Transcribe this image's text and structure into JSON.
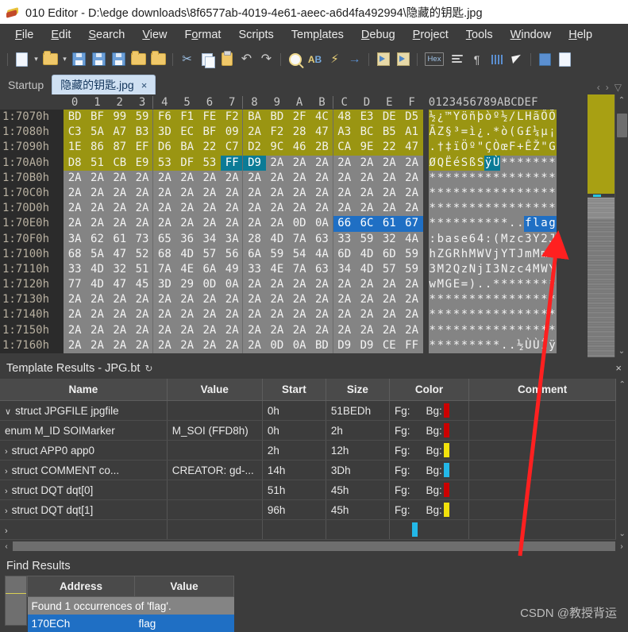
{
  "window": {
    "title": "010 Editor - D:\\edge downloads\\8f6577ab-4019-4e61-aeec-a6d4fa492994\\隐藏的钥匙.jpg",
    "app_icon": "010-editor-icon"
  },
  "menubar": {
    "items": [
      {
        "label": "File"
      },
      {
        "label": "Edit"
      },
      {
        "label": "Search"
      },
      {
        "label": "View"
      },
      {
        "label": "Format"
      },
      {
        "label": "Scripts"
      },
      {
        "label": "Templates"
      },
      {
        "label": "Debug"
      },
      {
        "label": "Project"
      },
      {
        "label": "Tools"
      },
      {
        "label": "Window"
      },
      {
        "label": "Help"
      }
    ]
  },
  "toolbar": {
    "buttons": [
      "new-file-icon",
      "new-file-dropdown-icon",
      "open-folder-icon",
      "open-dropdown-icon",
      "save-icon",
      "save-as-icon",
      "save-all-icon",
      "open-file-icon",
      "open-all-icon",
      "cut-icon",
      "copy-icon",
      "paste-icon",
      "undo-icon",
      "redo-icon",
      "find-icon",
      "replace-icon",
      "find-in-files-icon",
      "goto-icon",
      "run-script-icon",
      "run-template-icon",
      "hex-mode-button",
      "byte-order-icon",
      "paragraph-icon",
      "column-mode-icon",
      "inspector-icon",
      "calculator-icon",
      "help-icon"
    ],
    "hex_label": "Hex"
  },
  "tabs": {
    "items": [
      {
        "label": "Startup",
        "active": false,
        "closable": false
      },
      {
        "label": "隐藏的钥匙.jpg",
        "active": true,
        "closable": true,
        "close_label": "×"
      }
    ],
    "nav_prev": "‹",
    "nav_next": "›",
    "nav_list": "▽"
  },
  "hex_view": {
    "column_headers": [
      "0",
      "1",
      "2",
      "3",
      "4",
      "5",
      "6",
      "7",
      "8",
      "9",
      "A",
      "B",
      "C",
      "D",
      "E",
      "F"
    ],
    "ascii_header": "0123456789ABCDEF",
    "rows": [
      {
        "addr": "1:7070h",
        "bytes": [
          "BD",
          "BF",
          "99",
          "59",
          "F6",
          "F1",
          "FE",
          "F2",
          "BA",
          "BD",
          "2F",
          "4C",
          "48",
          "E3",
          "DE",
          "D5"
        ],
        "hl": [
          "o",
          "o",
          "o",
          "o",
          "o",
          "o",
          "o",
          "o",
          "o",
          "o",
          "o",
          "o",
          "o",
          "o",
          "o",
          "o"
        ],
        "ascii": "½¿™Yöñþòº½/LHãŐÕ",
        "ascii_hl": "o"
      },
      {
        "addr": "1:7080h",
        "bytes": [
          "C3",
          "5A",
          "A7",
          "B3",
          "3D",
          "EC",
          "BF",
          "09",
          "2A",
          "F2",
          "28",
          "47",
          "A3",
          "BC",
          "B5",
          "A1"
        ],
        "hl": [
          "o",
          "o",
          "o",
          "o",
          "o",
          "o",
          "o",
          "o",
          "o",
          "o",
          "o",
          "o",
          "o",
          "o",
          "o",
          "o"
        ],
        "ascii": "ÃZ§³=ì¿.*ò(G£¼µ¡",
        "ascii_hl": "o"
      },
      {
        "addr": "1:7090h",
        "bytes": [
          "1E",
          "86",
          "87",
          "EF",
          "D6",
          "BA",
          "22",
          "C7",
          "D2",
          "9C",
          "46",
          "2B",
          "CA",
          "9E",
          "22",
          "47"
        ],
        "hl": [
          "o",
          "o",
          "o",
          "o",
          "o",
          "o",
          "o",
          "o",
          "o",
          "o",
          "o",
          "o",
          "o",
          "o",
          "o",
          "o"
        ],
        "ascii": ".†‡ïÖº\"ÇÒœF+ÊŽ\"G",
        "ascii_hl": "o"
      },
      {
        "addr": "1:70A0h",
        "bytes": [
          "D8",
          "51",
          "CB",
          "E9",
          "53",
          "DF",
          "53",
          "FF",
          "D9",
          "2A",
          "2A",
          "2A",
          "2A",
          "2A",
          "2A",
          "2A"
        ],
        "hl": [
          "o",
          "o",
          "o",
          "o",
          "o",
          "o",
          "o",
          "t",
          "t",
          "g",
          "g",
          "g",
          "g",
          "g",
          "g",
          "g"
        ],
        "ascii": "ØQËéSßSÿÙ*******",
        "ascii_hl": "mixed-olive-teal"
      },
      {
        "addr": "1:70B0h",
        "bytes": [
          "2A",
          "2A",
          "2A",
          "2A",
          "2A",
          "2A",
          "2A",
          "2A",
          "2A",
          "2A",
          "2A",
          "2A",
          "2A",
          "2A",
          "2A",
          "2A"
        ],
        "hl": [
          "g",
          "g",
          "g",
          "g",
          "g",
          "g",
          "g",
          "g",
          "g",
          "g",
          "g",
          "g",
          "g",
          "g",
          "g",
          "g"
        ],
        "ascii": "****************",
        "ascii_hl": "g"
      },
      {
        "addr": "1:70C0h",
        "bytes": [
          "2A",
          "2A",
          "2A",
          "2A",
          "2A",
          "2A",
          "2A",
          "2A",
          "2A",
          "2A",
          "2A",
          "2A",
          "2A",
          "2A",
          "2A",
          "2A"
        ],
        "hl": [
          "g",
          "g",
          "g",
          "g",
          "g",
          "g",
          "g",
          "g",
          "g",
          "g",
          "g",
          "g",
          "g",
          "g",
          "g",
          "g"
        ],
        "ascii": "****************",
        "ascii_hl": "g"
      },
      {
        "addr": "1:70D0h",
        "bytes": [
          "2A",
          "2A",
          "2A",
          "2A",
          "2A",
          "2A",
          "2A",
          "2A",
          "2A",
          "2A",
          "2A",
          "2A",
          "2A",
          "2A",
          "2A",
          "2A"
        ],
        "hl": [
          "g",
          "g",
          "g",
          "g",
          "g",
          "g",
          "g",
          "g",
          "g",
          "g",
          "g",
          "g",
          "g",
          "g",
          "g",
          "g"
        ],
        "ascii": "****************",
        "ascii_hl": "g"
      },
      {
        "addr": "1:70E0h",
        "bytes": [
          "2A",
          "2A",
          "2A",
          "2A",
          "2A",
          "2A",
          "2A",
          "2A",
          "2A",
          "2A",
          "0D",
          "0A",
          "66",
          "6C",
          "61",
          "67"
        ],
        "hl": [
          "g",
          "g",
          "g",
          "g",
          "g",
          "g",
          "g",
          "g",
          "g",
          "g",
          "g",
          "g",
          "b",
          "b",
          "b",
          "b"
        ],
        "ascii": "**********..flag",
        "ascii_hl": "gray-then-blue-4"
      },
      {
        "addr": "1:70F0h",
        "bytes": [
          "3A",
          "62",
          "61",
          "73",
          "65",
          "36",
          "34",
          "3A",
          "28",
          "4D",
          "7A",
          "63",
          "33",
          "59",
          "32",
          "4A"
        ],
        "hl": [
          "g",
          "g",
          "g",
          "g",
          "g",
          "g",
          "g",
          "g",
          "g",
          "g",
          "g",
          "g",
          "g",
          "g",
          "g",
          "g"
        ],
        "ascii": ":base64:(Mzc3Y2J",
        "ascii_hl": "g"
      },
      {
        "addr": "1:7100h",
        "bytes": [
          "68",
          "5A",
          "47",
          "52",
          "68",
          "4D",
          "57",
          "56",
          "6A",
          "59",
          "54",
          "4A",
          "6D",
          "4D",
          "6D",
          "59"
        ],
        "hl": [
          "g",
          "g",
          "g",
          "g",
          "g",
          "g",
          "g",
          "g",
          "g",
          "g",
          "g",
          "g",
          "g",
          "g",
          "g",
          "g"
        ],
        "ascii": "hZGRhMWVjYTJmMmY",
        "ascii_hl": "g"
      },
      {
        "addr": "1:7110h",
        "bytes": [
          "33",
          "4D",
          "32",
          "51",
          "7A",
          "4E",
          "6A",
          "49",
          "33",
          "4E",
          "7A",
          "63",
          "34",
          "4D",
          "57",
          "59"
        ],
        "hl": [
          "g",
          "g",
          "g",
          "g",
          "g",
          "g",
          "g",
          "g",
          "g",
          "g",
          "g",
          "g",
          "g",
          "g",
          "g",
          "g"
        ],
        "ascii": "3M2QzNjI3Nzc4MWY",
        "ascii_hl": "g"
      },
      {
        "addr": "1:7120h",
        "bytes": [
          "77",
          "4D",
          "47",
          "45",
          "3D",
          "29",
          "0D",
          "0A",
          "2A",
          "2A",
          "2A",
          "2A",
          "2A",
          "2A",
          "2A",
          "2A"
        ],
        "hl": [
          "g",
          "g",
          "g",
          "g",
          "g",
          "g",
          "g",
          "g",
          "g",
          "g",
          "g",
          "g",
          "g",
          "g",
          "g",
          "g"
        ],
        "ascii": "wMGE=)..********",
        "ascii_hl": "g"
      },
      {
        "addr": "1:7130h",
        "bytes": [
          "2A",
          "2A",
          "2A",
          "2A",
          "2A",
          "2A",
          "2A",
          "2A",
          "2A",
          "2A",
          "2A",
          "2A",
          "2A",
          "2A",
          "2A",
          "2A"
        ],
        "hl": [
          "g",
          "g",
          "g",
          "g",
          "g",
          "g",
          "g",
          "g",
          "g",
          "g",
          "g",
          "g",
          "g",
          "g",
          "g",
          "g"
        ],
        "ascii": "****************",
        "ascii_hl": "g"
      },
      {
        "addr": "1:7140h",
        "bytes": [
          "2A",
          "2A",
          "2A",
          "2A",
          "2A",
          "2A",
          "2A",
          "2A",
          "2A",
          "2A",
          "2A",
          "2A",
          "2A",
          "2A",
          "2A",
          "2A"
        ],
        "hl": [
          "g",
          "g",
          "g",
          "g",
          "g",
          "g",
          "g",
          "g",
          "g",
          "g",
          "g",
          "g",
          "g",
          "g",
          "g",
          "g"
        ],
        "ascii": "****************",
        "ascii_hl": "g"
      },
      {
        "addr": "1:7150h",
        "bytes": [
          "2A",
          "2A",
          "2A",
          "2A",
          "2A",
          "2A",
          "2A",
          "2A",
          "2A",
          "2A",
          "2A",
          "2A",
          "2A",
          "2A",
          "2A",
          "2A"
        ],
        "hl": [
          "g",
          "g",
          "g",
          "g",
          "g",
          "g",
          "g",
          "g",
          "g",
          "g",
          "g",
          "g",
          "g",
          "g",
          "g",
          "g"
        ],
        "ascii": "****************",
        "ascii_hl": "g"
      },
      {
        "addr": "1:7160h",
        "bytes": [
          "2A",
          "2A",
          "2A",
          "2A",
          "2A",
          "2A",
          "2A",
          "2A",
          "2A",
          "0D",
          "0A",
          "BD",
          "D9",
          "D9",
          "CE",
          "FF"
        ],
        "hl": [
          "g",
          "g",
          "g",
          "g",
          "g",
          "g",
          "g",
          "g",
          "g",
          "g",
          "g",
          "g",
          "g",
          "g",
          "g",
          "g"
        ],
        "ascii": "*********..½ÙÙÎÿ",
        "ascii_hl": "g"
      }
    ],
    "scroll_up": "⌃",
    "scroll_down": "⌄"
  },
  "template_results": {
    "title": "Template Results - JPG.bt",
    "refresh_icon": "refresh-icon",
    "close_icon": "close-icon",
    "columns": [
      "Name",
      "Value",
      "Start",
      "Size",
      "Color",
      "Comment"
    ],
    "rows": [
      {
        "expander": "∨",
        "indent": 0,
        "name": "struct JPGFILE jpgfile",
        "value": "",
        "start": "0h",
        "size": "51BEDh",
        "fg": "Fg:",
        "bg": "Bg:",
        "swatch": "#cc0000",
        "comment": ""
      },
      {
        "expander": "",
        "indent": 1,
        "name": "enum M_ID SOIMarker",
        "value": "M_SOI (FFD8h)",
        "start": "0h",
        "size": "2h",
        "fg": "Fg:",
        "bg": "Bg:",
        "swatch": "#cc0000",
        "comment": ""
      },
      {
        "expander": "›",
        "indent": 1,
        "name": "struct APP0 app0",
        "value": "",
        "start": "2h",
        "size": "12h",
        "fg": "Fg:",
        "bg": "Bg:",
        "swatch": "#f2e20c",
        "comment": ""
      },
      {
        "expander": "›",
        "indent": 1,
        "name": "struct COMMENT co...",
        "value": "CREATOR: gd-...",
        "start": "14h",
        "size": "3Dh",
        "fg": "Fg:",
        "bg": "Bg:",
        "swatch": "#23b8e8",
        "comment": ""
      },
      {
        "expander": "›",
        "indent": 1,
        "name": "struct DQT dqt[0]",
        "value": "",
        "start": "51h",
        "size": "45h",
        "fg": "Fg:",
        "bg": "Bg:",
        "swatch": "#cc0000",
        "comment": ""
      },
      {
        "expander": "›",
        "indent": 1,
        "name": "struct DQT dqt[1]",
        "value": "",
        "start": "96h",
        "size": "45h",
        "fg": "Fg:",
        "bg": "Bg:",
        "swatch": "#f2e20c",
        "comment": ""
      },
      {
        "expander": "›",
        "indent": 1,
        "name": "",
        "value": "",
        "start": "",
        "size": "",
        "fg": "",
        "bg": "",
        "swatch": "#23b8e8",
        "comment": ""
      }
    ],
    "hscroll_left": "‹",
    "hscroll_right": "›",
    "vscroll_up": "⌃",
    "vscroll_down": "⌄"
  },
  "find_results": {
    "title": "Find Results",
    "columns": [
      "Address",
      "Value"
    ],
    "message": "Found 1 occurrences of 'flag'.",
    "rows": [
      {
        "address": "170ECh",
        "value": "flag",
        "selected": true
      }
    ]
  },
  "annotation": {
    "arrow_color": "#ff2020",
    "arrow_name": "red-pointer-arrow"
  },
  "watermark": {
    "text": "CSDN @教授背运"
  },
  "colors": {
    "olive_highlight": "#9a9512",
    "gray_region": "#848484",
    "teal_selection": "#0b7b96",
    "blue_selection": "#1f6fc4",
    "window_bg": "#3c3c3c",
    "titlebar_bg": "#ffffff"
  }
}
